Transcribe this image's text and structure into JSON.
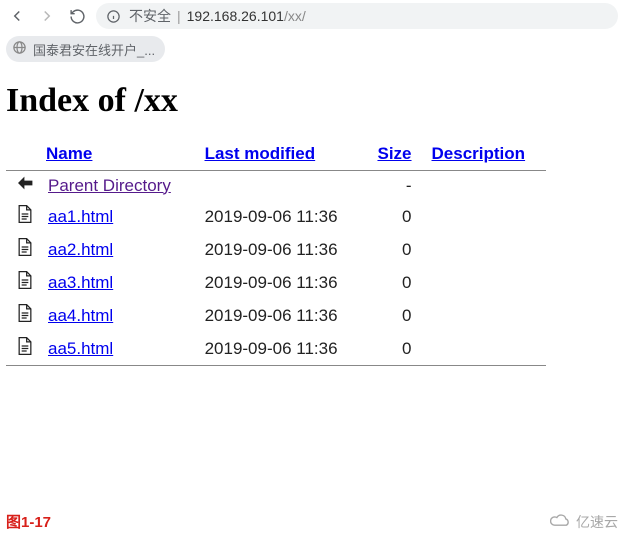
{
  "browser": {
    "insecure_label": "不安全",
    "url_host": "192.168.26.101",
    "url_path": "/xx/"
  },
  "bookmarks": {
    "chip1": "国泰君安在线开户_..."
  },
  "page": {
    "heading": "Index of /xx"
  },
  "table": {
    "headers": {
      "name": "Name",
      "modified": "Last modified",
      "size": "Size",
      "description": "Description"
    },
    "parent": {
      "label": "Parent Directory",
      "size": "-"
    },
    "rows": [
      {
        "name": "aa1.html",
        "modified": "2019-09-06 11:36",
        "size": "0"
      },
      {
        "name": "aa2.html",
        "modified": "2019-09-06 11:36",
        "size": "0"
      },
      {
        "name": "aa3.html",
        "modified": "2019-09-06 11:36",
        "size": "0"
      },
      {
        "name": "aa4.html",
        "modified": "2019-09-06 11:36",
        "size": "0"
      },
      {
        "name": "aa5.html",
        "modified": "2019-09-06 11:36",
        "size": "0"
      }
    ]
  },
  "footer": {
    "figure_label": "图1-17",
    "watermark": "亿速云"
  }
}
